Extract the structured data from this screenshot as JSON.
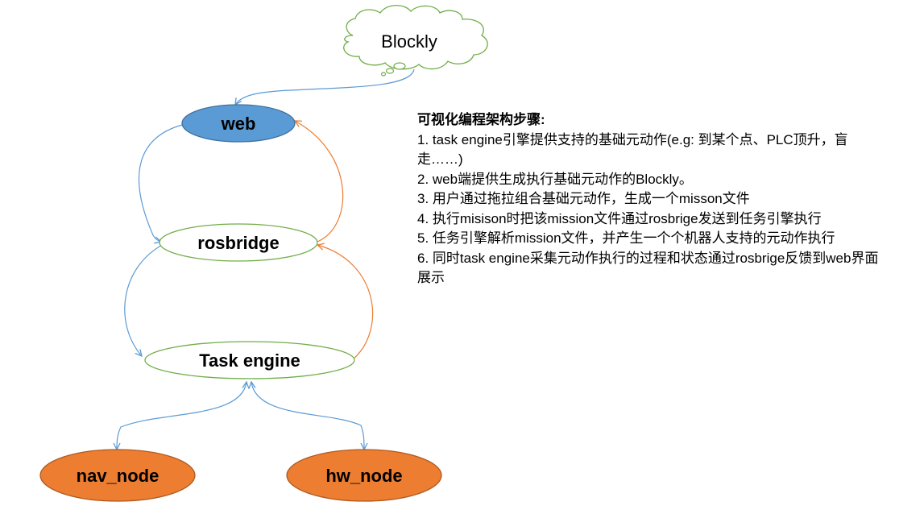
{
  "nodes": {
    "blockly": "Blockly",
    "web": "web",
    "rosbridge": "rosbridge",
    "task_engine": "Task engine",
    "nav_node": "nav_node",
    "hw_node": "hw_node"
  },
  "colors": {
    "blue_fill": "#5b9bd5",
    "orange_fill": "#ed7d31",
    "green_stroke": "#70ad47",
    "blue_arrow": "#5b9bd5",
    "orange_arrow": "#ed7d31"
  },
  "steps": {
    "title": "可视化编程架构步骤:",
    "items": [
      "1. task engine引擎提供支持的基础元动作(e.g: 到某个点、PLC顶升，盲走……)",
      "2. web端提供生成执行基础元动作的Blockly。",
      "3. 用户通过拖拉组合基础元动作，生成一个misson文件",
      "4. 执行misison时把该mission文件通过rosbrige发送到任务引擎执行",
      "5. 任务引擎解析mission文件，并产生一个个机器人支持的元动作执行",
      "6. 同时task engine采集元动作执行的过程和状态通过rosbrige反馈到web界面展示"
    ]
  }
}
